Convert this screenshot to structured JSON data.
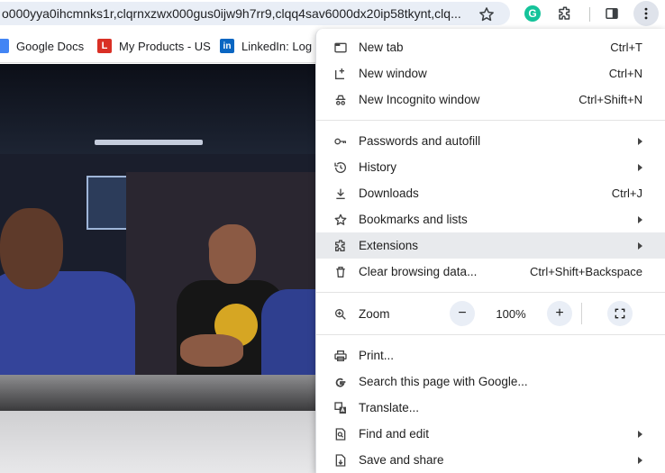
{
  "address_bar": {
    "url": "o000yya0ihcmnks1r,clqrnxzwx000gus0ijw9h7rr9,clqq4sav6000dx20ip58tkynt,clq...",
    "icons": [
      "star-icon",
      "grammarly-icon",
      "extensions-puzzle-icon",
      "side-panel-icon",
      "more-menu-icon"
    ],
    "grammarly_letter": "G"
  },
  "bookmarks": [
    {
      "label": "Google Docs",
      "icon": "google-docs-icon",
      "icon_text": ""
    },
    {
      "label": "My Products - US",
      "icon": "my-products-icon",
      "icon_text": "L"
    },
    {
      "label": "LinkedIn: Log In",
      "icon": "linkedin-icon",
      "icon_text": "in"
    }
  ],
  "menu": {
    "items": [
      {
        "label": "New tab",
        "shortcut": "Ctrl+T",
        "icon": "new-tab-icon",
        "submenu": false
      },
      {
        "label": "New window",
        "shortcut": "Ctrl+N",
        "icon": "new-window-icon",
        "submenu": false
      },
      {
        "label": "New Incognito window",
        "shortcut": "Ctrl+Shift+N",
        "icon": "incognito-icon",
        "submenu": false
      },
      {
        "label": "Passwords and autofill",
        "shortcut": "",
        "icon": "key-icon",
        "submenu": true
      },
      {
        "label": "History",
        "shortcut": "",
        "icon": "history-icon",
        "submenu": true
      },
      {
        "label": "Downloads",
        "shortcut": "Ctrl+J",
        "icon": "download-icon",
        "submenu": false
      },
      {
        "label": "Bookmarks and lists",
        "shortcut": "",
        "icon": "star-icon",
        "submenu": true
      },
      {
        "label": "Extensions",
        "shortcut": "",
        "icon": "extensions-icon",
        "submenu": true,
        "highlighted": true
      },
      {
        "label": "Clear browsing data...",
        "shortcut": "Ctrl+Shift+Backspace",
        "icon": "trash-icon",
        "submenu": false
      },
      {
        "label": "Print...",
        "shortcut": "",
        "icon": "print-icon",
        "submenu": false
      },
      {
        "label": "Search this page with Google...",
        "shortcut": "",
        "icon": "google-g-icon",
        "submenu": false
      },
      {
        "label": "Translate...",
        "shortcut": "",
        "icon": "translate-icon",
        "submenu": false
      },
      {
        "label": "Find and edit",
        "shortcut": "",
        "icon": "find-icon",
        "submenu": true
      },
      {
        "label": "Save and share",
        "shortcut": "",
        "icon": "save-share-icon",
        "submenu": true
      }
    ],
    "zoom": {
      "label": "Zoom",
      "value": "100%",
      "minus": "−",
      "plus": "+",
      "icon": "zoom-icon",
      "fullscreen_icon": "fullscreen-icon"
    }
  },
  "colors": {
    "menu_hover": "#e8eaed",
    "url_bar": "#e9eef6",
    "grammarly": "#15c39a"
  }
}
